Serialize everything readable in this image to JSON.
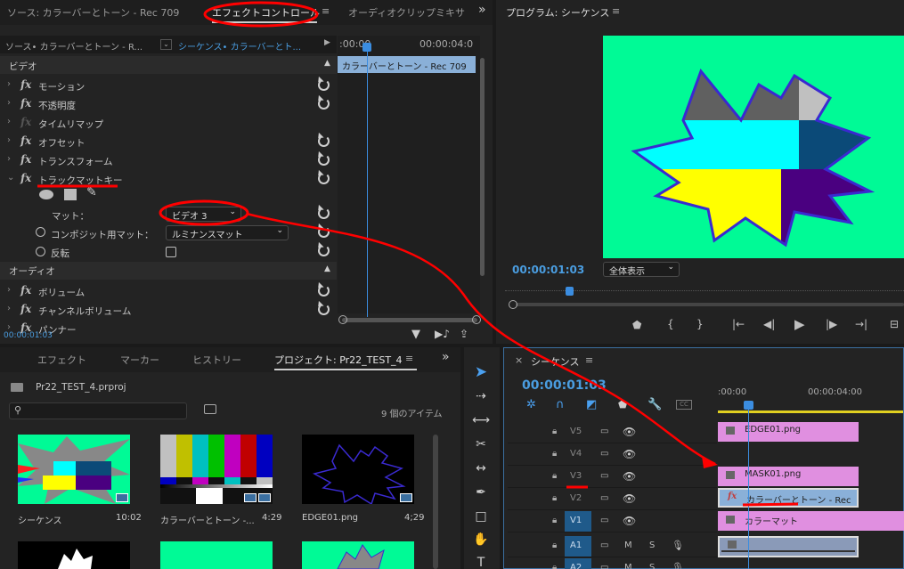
{
  "colors": {
    "accent_blue": "#3b8de0",
    "clip_pink": "#e08fe0",
    "clip_blue": "#8ab0d8",
    "program_bg": "#00fa96",
    "annotation_red": "#ff0000"
  },
  "source_panel": {
    "tab_source": "ソース: カラーバーとトーン - Rec 709",
    "tab_effect_controls": "エフェクトコントロール",
    "tab_audio_mixer": "オーディオクリップミキサ",
    "overflow": "»",
    "menu": "≡"
  },
  "effect_controls": {
    "source_selector": "ソース• カラーバーとトーン - R...",
    "sequence_selector": "シーケンス• カラーバーとト...",
    "time_start": ":00:00",
    "time_end": "00:00:04:0",
    "clip_label": "カラーバーとトーン - Rec 709",
    "section_video": "ビデオ",
    "effects": [
      {
        "label": "モーション",
        "fx_enabled": true
      },
      {
        "label": "不透明度",
        "fx_enabled": true
      },
      {
        "label": "タイムリマップ",
        "fx_enabled": false
      },
      {
        "label": "オフセット",
        "fx_enabled": true
      },
      {
        "label": "トランスフォーム",
        "fx_enabled": true
      },
      {
        "label": "トラックマットキー",
        "fx_enabled": true
      }
    ],
    "matte_label": "マット：",
    "matte_value": "ビデオ 3",
    "composite_label": "コンポジット用マット：",
    "composite_value": "ルミナンスマット",
    "reverse_label": "反転",
    "section_audio": "オーディオ",
    "audio_effects": [
      {
        "label": "ボリューム"
      },
      {
        "label": "チャンネルボリューム"
      },
      {
        "label": "パンナー"
      }
    ],
    "current_time": "00:00:01:03"
  },
  "program_monitor": {
    "title": "プログラム: シーケンス",
    "menu": "≡",
    "timecode": "00:00:01:03",
    "zoom": "全体表示"
  },
  "project_panel": {
    "tabs": [
      "エフェクト",
      "マーカー",
      "ヒストリー",
      "プロジェクト: Pr22_TEST_4"
    ],
    "menu": "≡",
    "overflow": "»",
    "project_file": "Pr22_TEST_4.prproj",
    "item_count": "9 個のアイテム",
    "items": [
      {
        "name": "シーケンス",
        "duration": "10:02"
      },
      {
        "name": "カラーバーとトーン -...",
        "duration": "4:29"
      },
      {
        "name": "EDGE01.png",
        "duration": "4;29"
      }
    ]
  },
  "timeline": {
    "close": "×",
    "title": "シーケンス",
    "menu": "≡",
    "timecode": "00:00:01:03",
    "ruler_start": ":00:00",
    "ruler_mid": "00:00:04:00",
    "tracks": [
      {
        "name": "V5",
        "clip": "EDGE01.png"
      },
      {
        "name": "V4",
        "clip": ""
      },
      {
        "name": "V3",
        "clip": "MASK01.png"
      },
      {
        "name": "V2",
        "clip": "カラーバーとトーン - Rec"
      },
      {
        "name": "V1",
        "clip": "カラーマット"
      },
      {
        "name": "A1",
        "clip": ""
      },
      {
        "name": "A2",
        "clip": ""
      }
    ],
    "audio_mute": "M",
    "audio_solo": "S"
  }
}
